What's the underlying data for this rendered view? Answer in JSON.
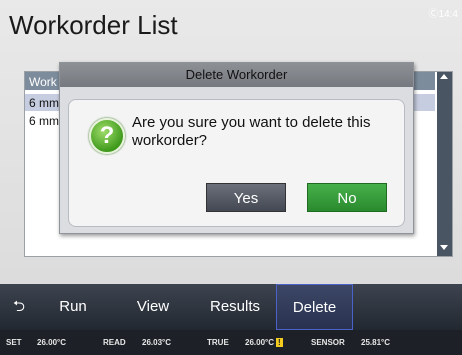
{
  "header": {
    "title": "Workorder List",
    "clock": "Ⓒ14:4"
  },
  "list": {
    "header": "Work",
    "rows": [
      "6 mm",
      "6 mm"
    ]
  },
  "dialog": {
    "title": "Delete Workorder",
    "message": "Are you sure you want to delete this workorder?",
    "yes_label": "Yes",
    "no_label": "No",
    "icon": "question-icon"
  },
  "toolbar": {
    "back_icon": "⮌",
    "run": "Run",
    "view": "View",
    "results": "Results",
    "delete": "Delete"
  },
  "status": {
    "set_label": "SET",
    "set_value": "26.00°C",
    "read_label": "READ",
    "read_value": "26.03°C",
    "true_label": "TRUE",
    "true_value": "26.00°C",
    "warn": "!",
    "sensor_label": "SENSOR",
    "sensor_value": "25.81°C"
  }
}
